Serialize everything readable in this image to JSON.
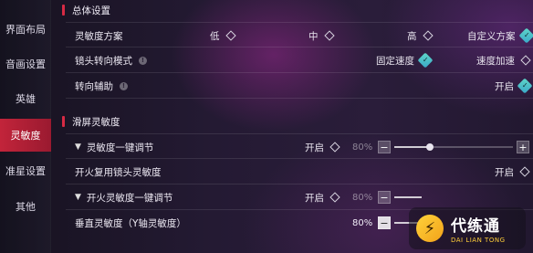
{
  "sidebar": {
    "items": [
      {
        "label": "界面布局"
      },
      {
        "label": "音画设置"
      },
      {
        "label": "英雄"
      },
      {
        "label": "灵敏度",
        "active": true
      },
      {
        "label": "准星设置"
      },
      {
        "label": "其他"
      }
    ]
  },
  "sections": {
    "general": {
      "title": "总体设置"
    },
    "swipe": {
      "title": "滑屏灵敏度"
    }
  },
  "rows": {
    "sensitivity_scheme": {
      "label": "灵敏度方案",
      "options": [
        "低",
        "中",
        "高",
        "自定义方案"
      ],
      "selected": "自定义方案"
    },
    "lens_turn_mode": {
      "label": "镜头转向模式",
      "options": [
        "固定速度",
        "速度加速"
      ],
      "selected": "固定速度"
    },
    "turn_assist": {
      "label": "转向辅助",
      "option": "开启",
      "checked": true
    },
    "one_key_sens": {
      "label": "灵敏度一键调节",
      "toggle": "开启",
      "checked": false,
      "value": "80%",
      "level": 80,
      "enabled": false
    },
    "fire_reuse": {
      "label": "开火复用镜头灵敏度",
      "option": "开启",
      "checked": false
    },
    "fire_one_key_sens": {
      "label": "开火灵敏度一键调节",
      "toggle": "开启",
      "checked": false,
      "value": "80%",
      "level": 80,
      "enabled": false
    },
    "vertical_sens": {
      "label": "垂直灵敏度（Y轴灵敏度）",
      "value": "80%",
      "level": 80,
      "enabled": true
    }
  },
  "icons": {
    "info": "info-icon",
    "chevron": "chevron-down-icon",
    "radio_off": "diamond-radio-icon",
    "radio_on": "checked-diamond-icon"
  },
  "controls": {
    "minus": "−",
    "plus": "+"
  },
  "watermark": {
    "cn": "代练通",
    "en": "DAI LIAN TONG"
  },
  "colors": {
    "accent": "#d62a44",
    "check": "#4fc4c8",
    "active_tab": "#c2243a"
  }
}
